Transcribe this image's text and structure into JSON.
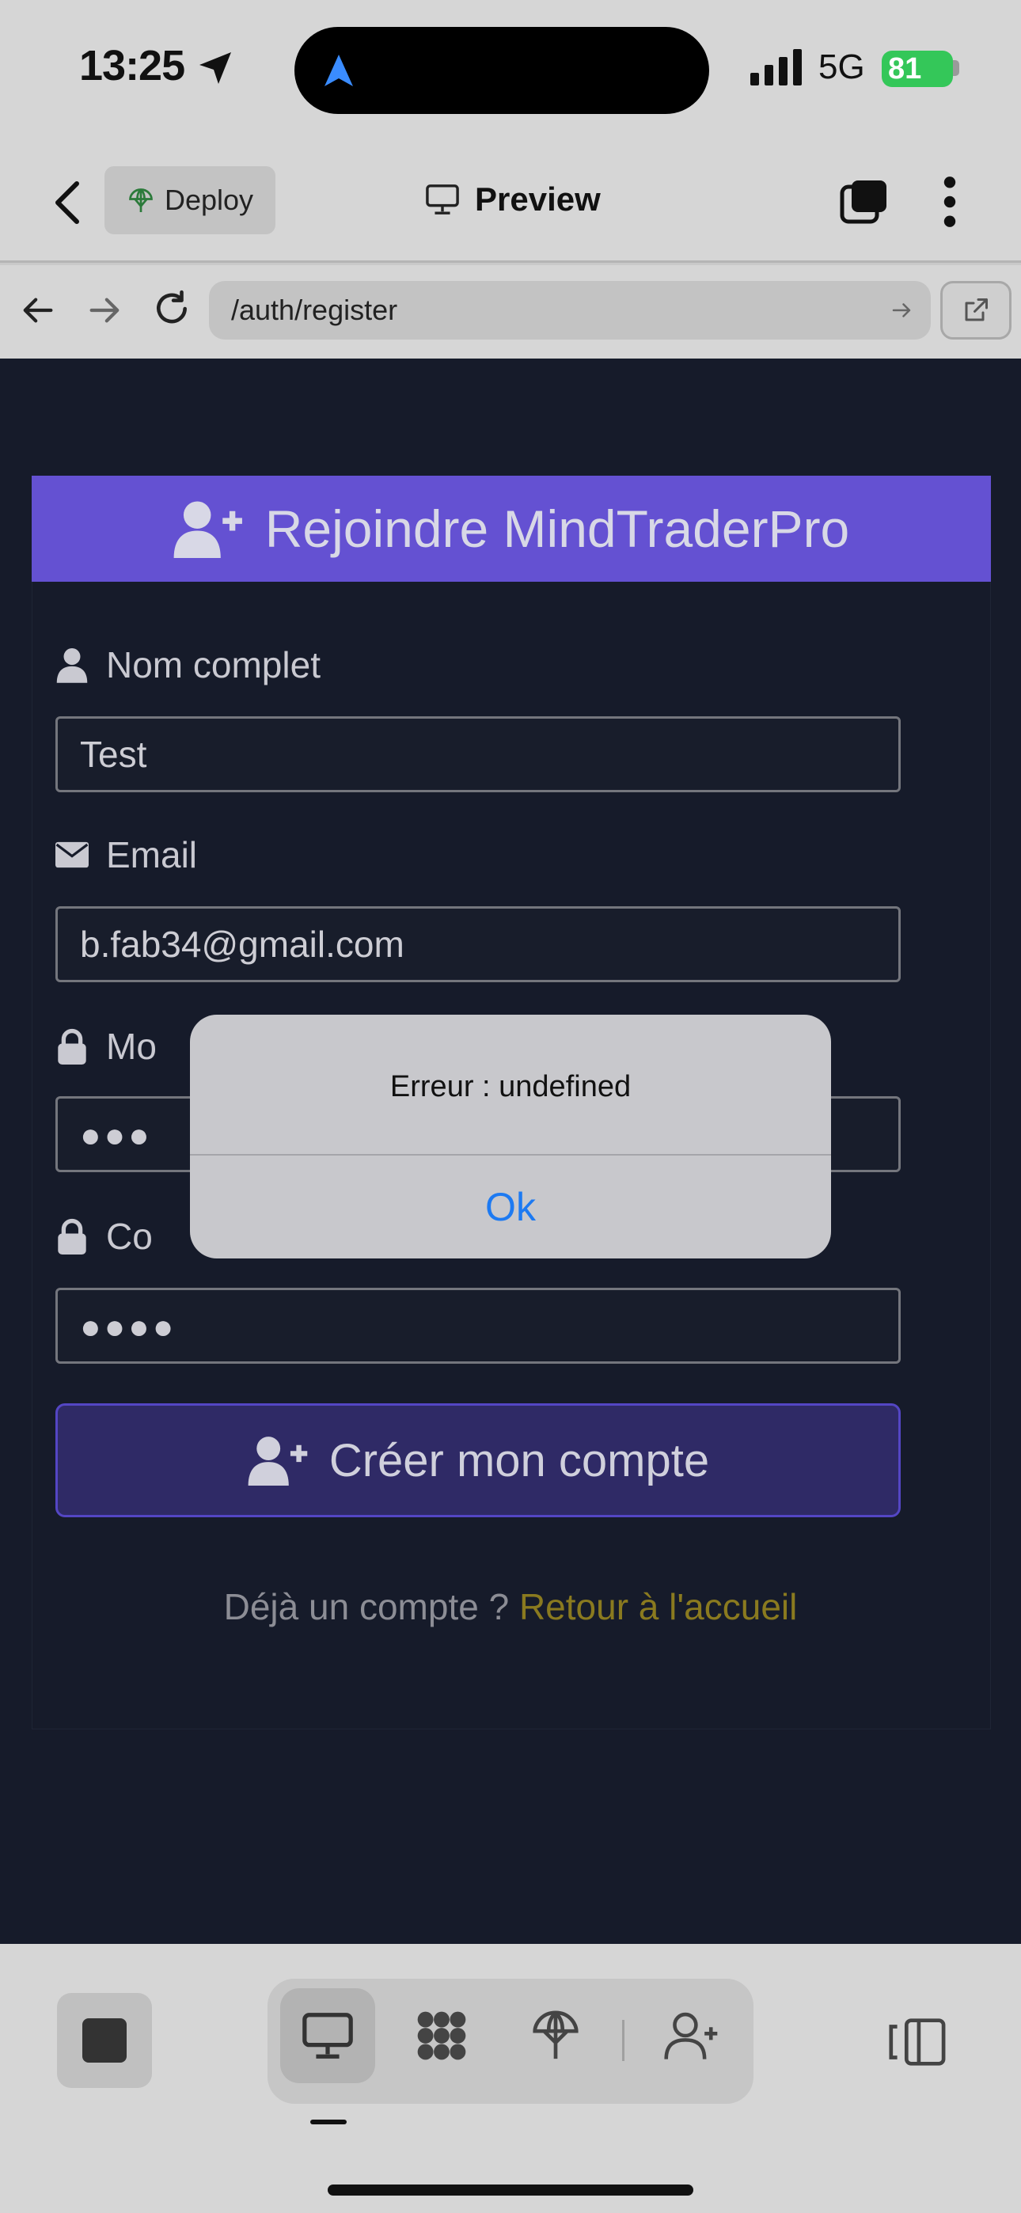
{
  "status_bar": {
    "time": "13:25",
    "network": "5G",
    "battery": "81"
  },
  "header": {
    "deploy_label": "Deploy",
    "preview_label": "Preview"
  },
  "browser": {
    "url": "/auth/register"
  },
  "form": {
    "title": "Rejoindre MindTraderPro",
    "name_label": "Nom complet",
    "name_value": "Test",
    "email_label": "Email",
    "email_value": "b.fab34@gmail.com",
    "password_label_visible": "Mo",
    "password_value": "●●●",
    "confirm_label_visible": "Co",
    "confirm_value": "●●●●",
    "submit_label": "Créer mon compte",
    "login_prompt": "Déjà un compte ? ",
    "login_link": "Retour à l'accueil"
  },
  "alert": {
    "message": "Erreur : undefined",
    "ok_label": "Ok"
  },
  "colors": {
    "header": "#6451d2",
    "page_bg": "#161b2a",
    "link": "#8a7a1f",
    "ios_blue": "#1d7af2",
    "battery": "#34c759"
  },
  "icons": [
    "location-arrow-icon",
    "navigation-icon",
    "signal-icon",
    "battery-icon",
    "chevron-left-icon",
    "deploy-globe-icon",
    "monitor-icon",
    "tabs-icon",
    "more-vertical-icon",
    "arrow-left-icon",
    "arrow-right-icon",
    "reload-icon",
    "external-link-icon",
    "user-plus-icon",
    "user-icon",
    "envelope-icon",
    "lock-icon",
    "stop-icon",
    "grid-icon",
    "publish-icon",
    "sidebar-toggle-icon"
  ]
}
